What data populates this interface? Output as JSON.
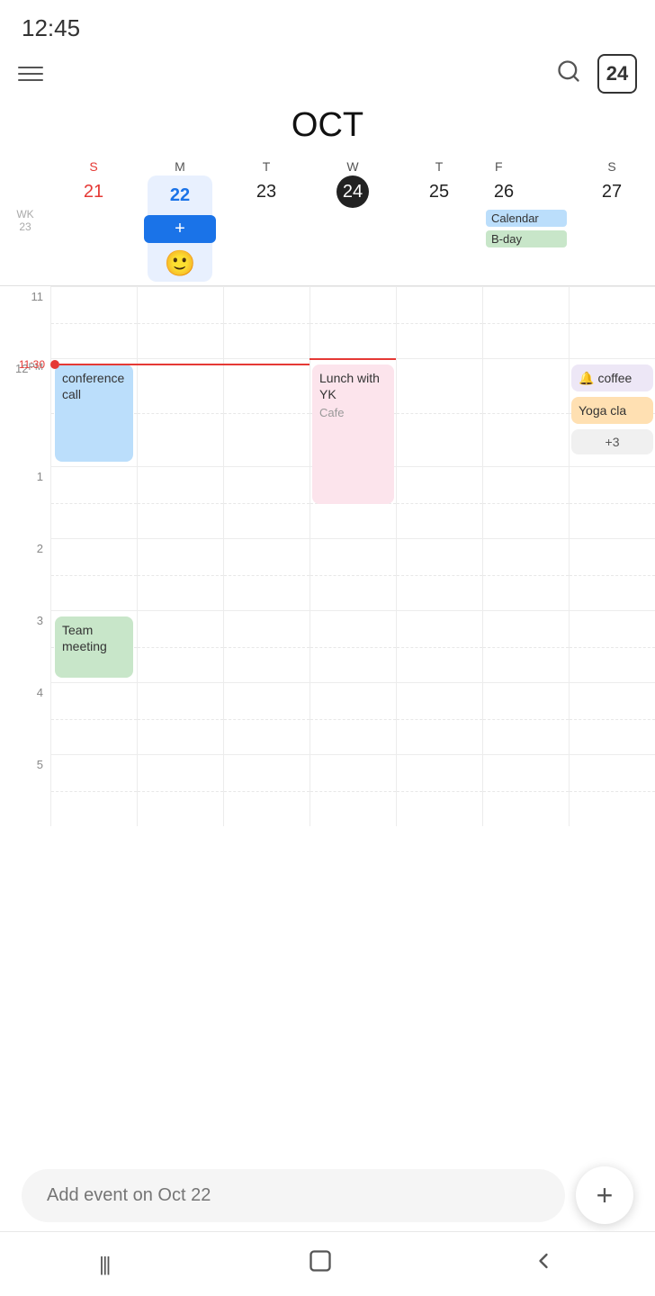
{
  "statusBar": {
    "time": "12:45"
  },
  "toolbar": {
    "hamburgerLabel": "menu",
    "searchLabel": "search",
    "dateBadge": "24"
  },
  "calendar": {
    "monthTitle": "OCT",
    "weekLabel": "WK\n23",
    "dayHeaders": [
      {
        "letter": "S",
        "number": "21",
        "isSun": true,
        "isToday": false,
        "isSelected": false
      },
      {
        "letter": "M",
        "number": "22",
        "isSun": false,
        "isToday": false,
        "isSelected": true
      },
      {
        "letter": "T",
        "number": "23",
        "isSun": false,
        "isToday": false,
        "isSelected": false
      },
      {
        "letter": "W",
        "number": "24",
        "isSun": false,
        "isToday": true,
        "isSelected": false
      },
      {
        "letter": "T",
        "number": "25",
        "isSun": false,
        "isToday": false,
        "isSelected": false
      },
      {
        "letter": "F",
        "number": "26",
        "isSun": false,
        "isToday": false,
        "isSelected": false
      },
      {
        "letter": "S",
        "number": "27",
        "isSun": false,
        "isToday": false,
        "isSelected": false
      }
    ],
    "fridayBadges": [
      {
        "text": "Calendar",
        "class": "cal-badge"
      },
      {
        "text": "B-day",
        "class": "bday-badge"
      }
    ],
    "currentTimeLabel": "11:30",
    "timeLabels": [
      "11",
      "12\nPM",
      "1",
      "2",
      "3",
      "4",
      "5"
    ],
    "events": [
      {
        "id": "conference-call",
        "title": "conference call",
        "day": 0,
        "color": "#bbdefb",
        "textColor": "#333"
      },
      {
        "id": "lunch-yk",
        "title": "Lunch with YK",
        "subtitle": "Cafe",
        "day": 3,
        "color": "#fce4ec",
        "textColor": "#333"
      },
      {
        "id": "coffee",
        "title": "🔔 coffee",
        "day": 6,
        "color": "#ede7f6",
        "textColor": "#333"
      },
      {
        "id": "yoga",
        "title": "Yoga cla",
        "day": 6,
        "color": "#ffe0b2",
        "textColor": "#333"
      },
      {
        "id": "more",
        "title": "+3",
        "day": 6,
        "color": "#f5f5f5",
        "textColor": "#333"
      },
      {
        "id": "team-meeting",
        "title": "Team meeting",
        "day": 0,
        "color": "#c8e6c9",
        "textColor": "#333"
      }
    ]
  },
  "addEvent": {
    "placeholder": "Add event on Oct 22"
  },
  "nav": {
    "icons": [
      "|||",
      "□",
      "<"
    ]
  }
}
